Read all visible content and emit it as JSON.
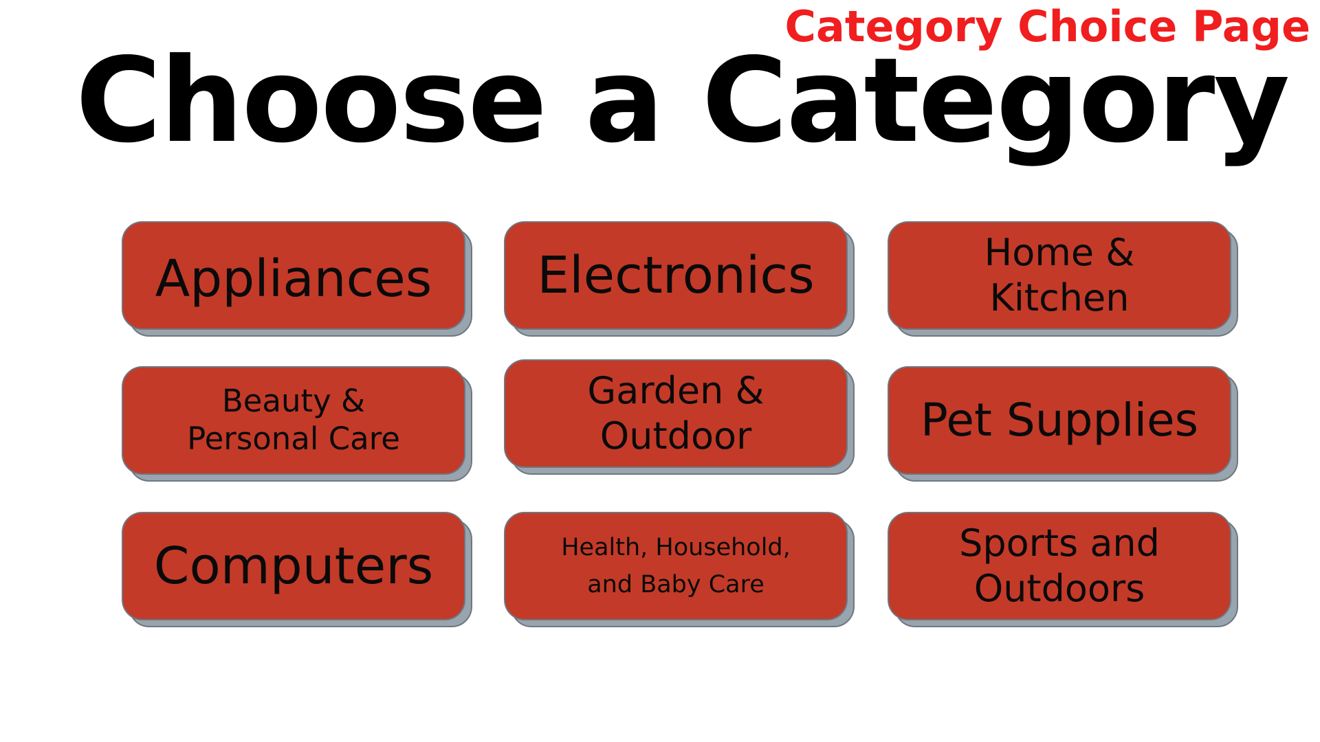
{
  "page_label": "Category Choice Page",
  "title": "Choose a Category",
  "categories": [
    {
      "label": "Appliances"
    },
    {
      "label": "Electronics"
    },
    {
      "label": "Home & Kitchen"
    },
    {
      "label": "Beauty & Personal Care"
    },
    {
      "label": "Garden & Outdoor"
    },
    {
      "label": "Pet Supplies"
    },
    {
      "label": "Computers"
    },
    {
      "label": "Health, Household, and Baby Care"
    },
    {
      "label": "Sports and Outdoors"
    }
  ],
  "colors": {
    "page_label": "#f01e1e",
    "tile_fill": "#c43a28",
    "tile_shadow": "#99a5ae",
    "tile_border": "#6d7780",
    "title": "#000000"
  }
}
